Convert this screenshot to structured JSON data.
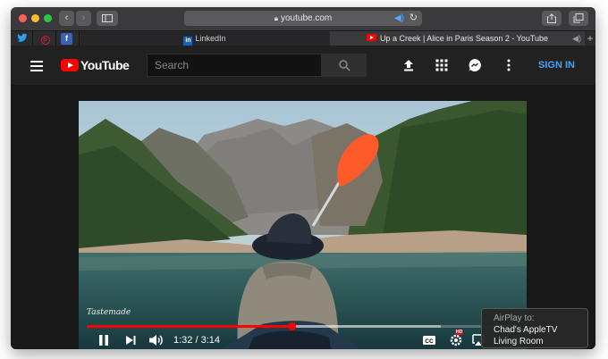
{
  "browser": {
    "url": "youtube.com",
    "pinned_tabs": [
      "twitter-icon",
      "pinterest-icon",
      "facebook-icon"
    ],
    "tabs": [
      {
        "label": "LinkedIn",
        "icon": "linkedin-icon"
      },
      {
        "label": "Up a Creek | Alice in Paris Season 2 - YouTube",
        "icon": "youtube-icon",
        "audio": true
      }
    ]
  },
  "header": {
    "logo_text": "YouTube",
    "search_placeholder": "Search",
    "signin_label": "SIGN IN"
  },
  "player": {
    "watermark": "Tastemade",
    "time": "1:32 / 3:14",
    "progress": 0.4742,
    "buffered": 0.82,
    "quality_badge": "HD"
  },
  "airplay": {
    "title": "AirPlay to:",
    "device_line1": "Chad's AppleTV",
    "device_line2": "Living Room"
  },
  "colors": {
    "accent": "#ff0000",
    "signin": "#3ea6ff",
    "window_bg": "#212121"
  }
}
